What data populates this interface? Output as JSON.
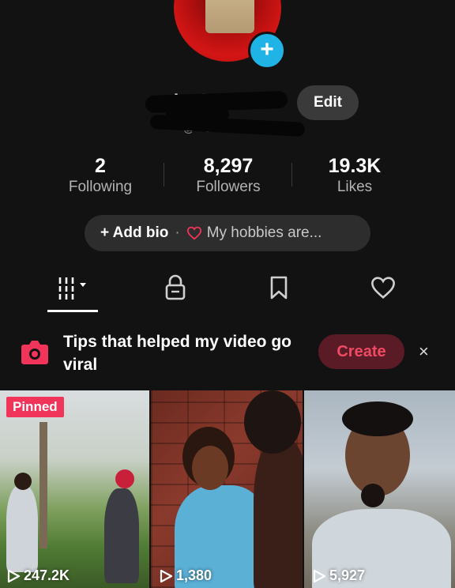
{
  "profile": {
    "username": "I···SAA",
    "handle": "@···aa",
    "edit_label": "Edit"
  },
  "stats": [
    {
      "value": "2",
      "label": "Following"
    },
    {
      "value": "8,297",
      "label": "Followers"
    },
    {
      "value": "19.3K",
      "label": "Likes"
    }
  ],
  "bio": {
    "add_label": "+ Add bio",
    "separator": "·",
    "hobbies_label": "My hobbies are..."
  },
  "tabs": [
    {
      "icon": "grid-videos-icon",
      "active": true
    },
    {
      "icon": "lock-icon",
      "active": false
    },
    {
      "icon": "bookmark-icon",
      "active": false
    },
    {
      "icon": "heart-icon",
      "active": false
    }
  ],
  "tip": {
    "text": "Tips that helped my video go viral",
    "create_label": "Create",
    "close_label": "×"
  },
  "videos": [
    {
      "pinned_label": "Pinned",
      "views": "247.2K"
    },
    {
      "views": "1,380"
    },
    {
      "views": "5,927"
    }
  ],
  "colors": {
    "background": "#121212",
    "accent_blue": "#20b4e6",
    "accent_pink": "#f0345a",
    "create_bg": "#5a1b27",
    "create_text": "#f04a63"
  }
}
